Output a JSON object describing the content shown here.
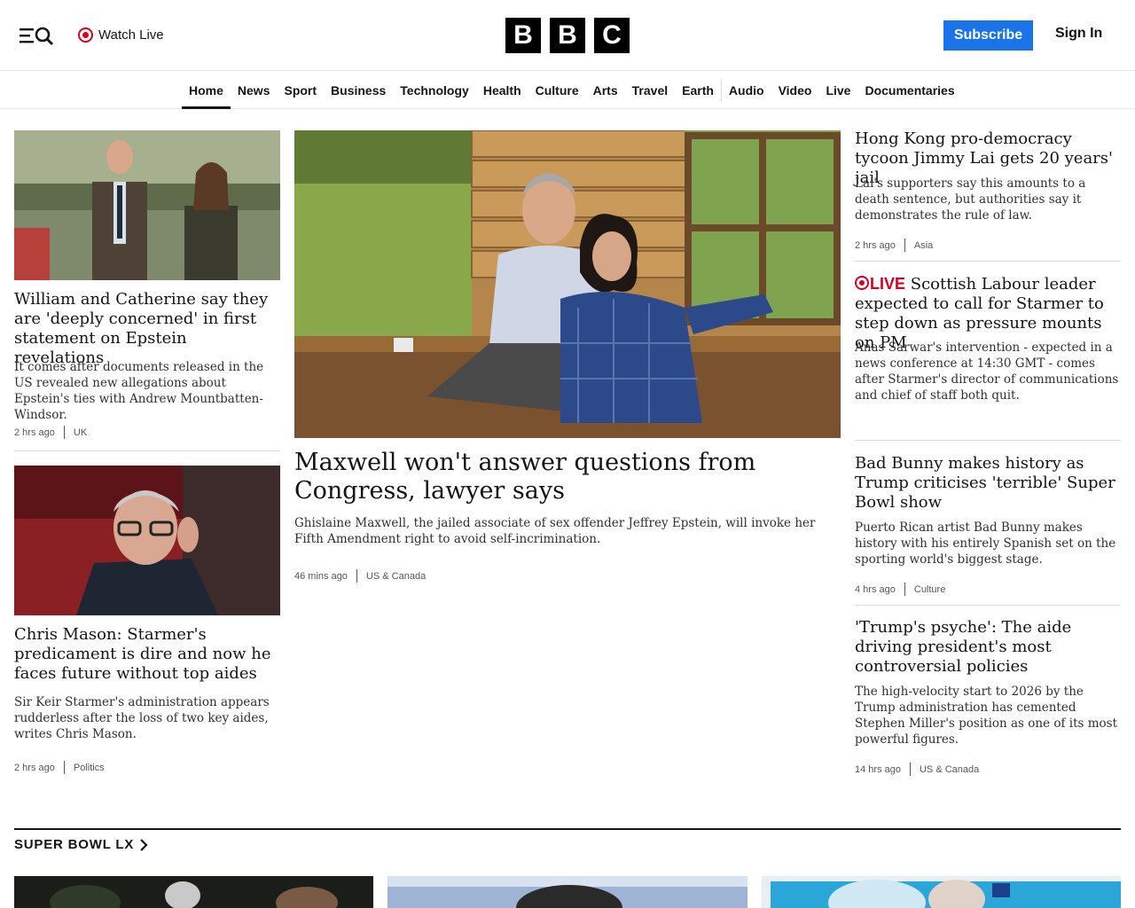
{
  "header": {
    "watch_live": "Watch Live",
    "logo_letters": [
      "B",
      "B",
      "C"
    ],
    "subscribe": "Subscribe",
    "sign_in": "Sign In"
  },
  "nav": {
    "items": [
      "Home",
      "News",
      "Sport",
      "Business",
      "Technology",
      "Health",
      "Culture",
      "Arts",
      "Travel",
      "Earth",
      "Audio",
      "Video",
      "Live",
      "Documentaries"
    ],
    "active": "Home"
  },
  "stories": {
    "left1": {
      "headline": "William and Catherine say they are 'deeply concerned' in first statement on Epstein revelations",
      "summary": "It comes after documents released in the US revealed new allegations about Epstein's ties with Andrew Mountbatten-Windsor.",
      "time": "2 hrs ago",
      "category": "UK"
    },
    "left2": {
      "headline": "Chris Mason: Starmer's predicament is dire and now he faces future without top aides",
      "summary": "Sir Keir Starmer's administration appears rudderless after the loss of two key aides, writes Chris Mason.",
      "time": "2 hrs ago",
      "category": "Politics"
    },
    "main": {
      "headline": "Maxwell won't answer questions from Congress, lawyer says",
      "summary": "Ghislaine Maxwell, the jailed associate of sex offender Jeffrey Epstein, will invoke her Fifth Amendment right to avoid self-incrimination.",
      "time": "46 mins ago",
      "category": "US & Canada"
    },
    "right1": {
      "headline": "Hong Kong pro-democracy tycoon Jimmy Lai gets 20 years' jail",
      "summary": "Lai's supporters say this amounts to a death sentence, but authorities say it demonstrates the rule of law.",
      "time": "2 hrs ago",
      "category": "Asia"
    },
    "right2": {
      "live_label": "LIVE",
      "headline": "Scottish Labour leader expected to call for Starmer to step down as pressure mounts on PM",
      "summary": "Anas Sarwar's intervention - expected in a news conference at 14:30 GMT - comes after Starmer's director of communications and chief of staff both quit."
    },
    "right3": {
      "headline": "Bad Bunny makes history as Trump criticises 'terrible' Super Bowl show",
      "summary": "Puerto Rican artist Bad Bunny makes history with his entirely Spanish set on the sporting world's biggest stage.",
      "time": "4 hrs ago",
      "category": "Culture"
    },
    "right4": {
      "headline": "'Trump's psyche': The aide driving president's most controversial policies",
      "summary": "The high-velocity start to 2026 by the Trump administration has cemented Stephen Miller's position as one of its most powerful figures.",
      "time": "14 hrs ago",
      "category": "US & Canada"
    }
  },
  "section": {
    "title": "SUPER BOWL LX"
  },
  "colors": {
    "brand_black": "#000000",
    "subscribe_blue": "#1a73e8",
    "live_red": "#d4001e"
  }
}
